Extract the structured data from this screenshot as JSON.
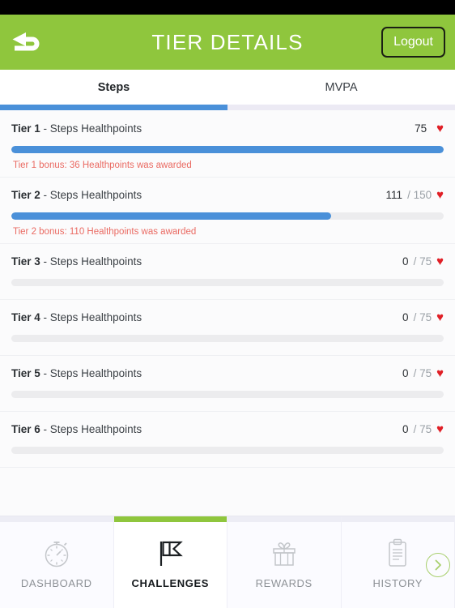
{
  "header": {
    "title": "TIER DETAILS",
    "back_icon": "back-arrow-icon",
    "logout_label": "Logout",
    "green": "#8fc63d"
  },
  "tabs": {
    "items": [
      {
        "label": "Steps",
        "active": true
      },
      {
        "label": "MVPA",
        "active": false
      }
    ],
    "indicator_color": "#4a90d9"
  },
  "tiers": [
    {
      "name": "Tier 1",
      "desc": "- Steps Healthpoints",
      "current": "75",
      "denom": "",
      "progress_pct": 100,
      "bonus": "Tier 1 bonus: 36 Healthpoints was awarded"
    },
    {
      "name": "Tier 2",
      "desc": "- Steps Healthpoints",
      "current": "111",
      "denom": "/ 150",
      "progress_pct": 74,
      "bonus": "Tier 2 bonus: 110 Healthpoints was awarded"
    },
    {
      "name": "Tier 3",
      "desc": "- Steps Healthpoints",
      "current": "0",
      "denom": "/ 75",
      "progress_pct": 0,
      "bonus": ""
    },
    {
      "name": "Tier 4",
      "desc": "- Steps Healthpoints",
      "current": "0",
      "denom": "/ 75",
      "progress_pct": 0,
      "bonus": ""
    },
    {
      "name": "Tier 5",
      "desc": "- Steps Healthpoints",
      "current": "0",
      "denom": "/ 75",
      "progress_pct": 0,
      "bonus": ""
    },
    {
      "name": "Tier 6",
      "desc": "- Steps Healthpoints",
      "current": "0",
      "denom": "/ 75",
      "progress_pct": 0,
      "bonus": ""
    }
  ],
  "heart_glyph": "♥",
  "heart_color": "#e01f26",
  "bottom_nav": {
    "items": [
      {
        "label": "DASHBOARD",
        "icon": "stopwatch-icon",
        "active": false
      },
      {
        "label": "CHALLENGES",
        "icon": "flag-icon",
        "active": true
      },
      {
        "label": "REWARDS",
        "icon": "gift-icon",
        "active": false
      },
      {
        "label": "HISTORY",
        "icon": "clipboard-icon",
        "active": false
      }
    ],
    "next_icon": "chevron-right-icon",
    "active_color": "#8fc63d"
  }
}
